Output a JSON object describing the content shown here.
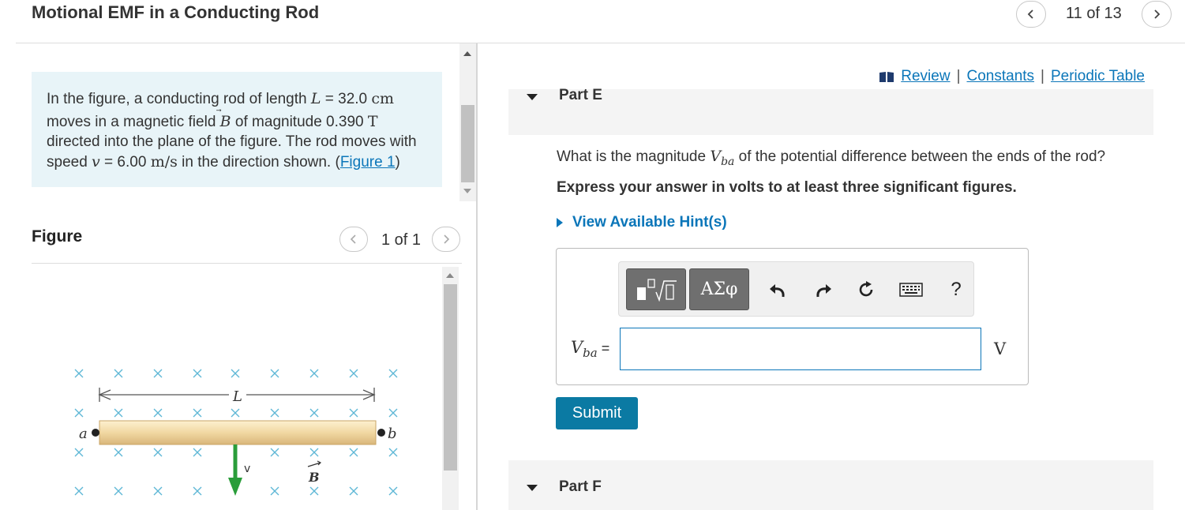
{
  "header": {
    "title": "Motional EMF in a Conducting Rod",
    "counter": "11 of 13"
  },
  "problem": {
    "t1": "In the figure, a conducting rod of length ",
    "L_sym": "L",
    "eq": " = ",
    "L_val": "32.0 ",
    "L_unit": "cm",
    "t2": "moves in a magnetic field ",
    "B_sym": "B",
    "t3": " of magnitude 0.390 ",
    "B_unit": "T",
    "t4": "directed into the plane of the figure. The rod moves with",
    "t5": "speed ",
    "v_sym": "v",
    "t6": " = 6.00 ",
    "v_unit": "m/s",
    "t7": " in the direction shown. (",
    "fig_link": "Figure 1",
    "t8": ")"
  },
  "figure": {
    "heading": "Figure",
    "counter": "1 of 1",
    "label_L": "L",
    "label_a": "a",
    "label_b": "b",
    "label_v": "v",
    "label_B": "B"
  },
  "links": {
    "review": "Review",
    "constants": "Constants",
    "periodic": "Periodic Table",
    "sep": "|"
  },
  "partE": {
    "label": "Part E",
    "q1": "What is the magnitude ",
    "V_sym": "V",
    "V_sub": "ba",
    "q2": " of the potential difference between the ends of the rod?",
    "instruction": "Express your answer in volts to at least three significant figures.",
    "hint": "View Available Hint(s)",
    "toolbar_greek": "ΑΣφ",
    "toolbar_help": "?",
    "var_V": "V",
    "var_sub": "ba",
    "var_eq": " =",
    "input_value": "",
    "unit": "V",
    "submit": "Submit"
  },
  "partF": {
    "label": "Part F"
  }
}
